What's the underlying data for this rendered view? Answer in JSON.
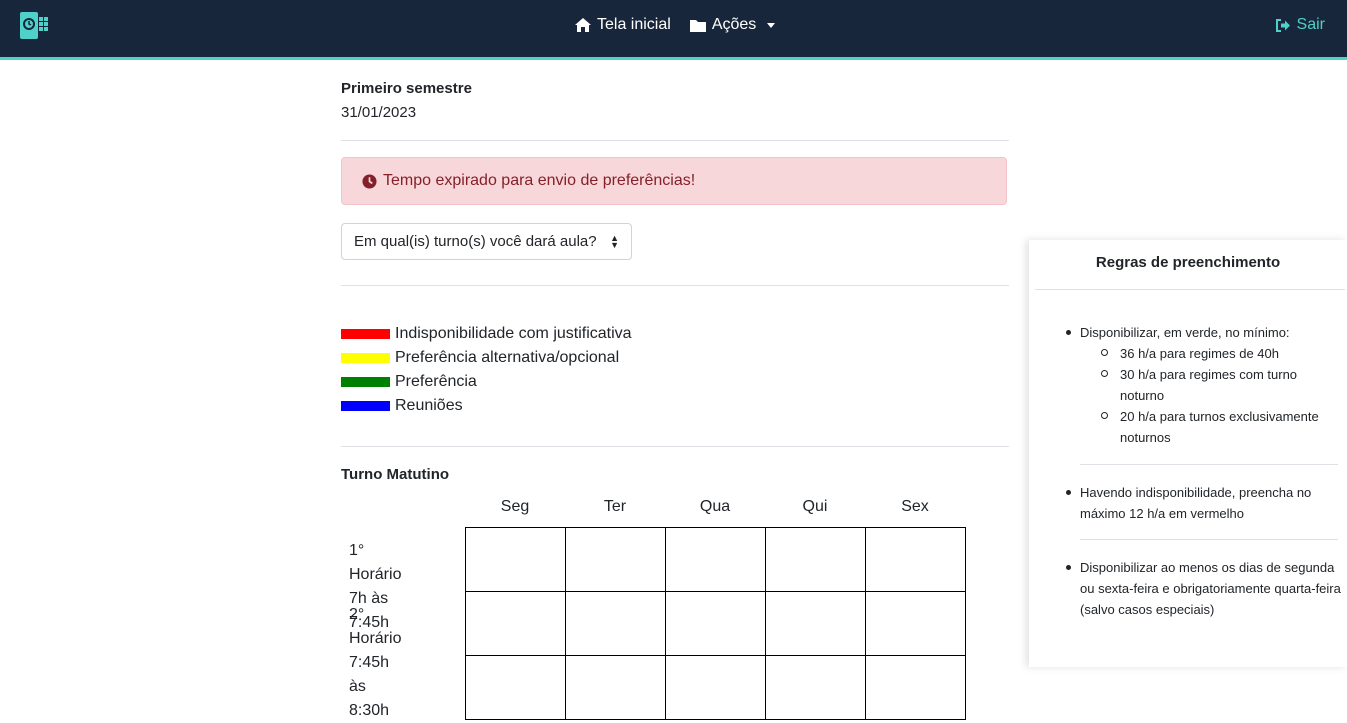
{
  "nav": {
    "home_label": "Tela inicial",
    "actions_label": "Ações",
    "logout_label": "Sair"
  },
  "semester": {
    "title": "Primeiro semestre",
    "date": "31/01/2023"
  },
  "alert": {
    "text": "Tempo expirado para envio de preferências!"
  },
  "shift_select": {
    "value": "Em qual(is) turno(s) você dará aula?"
  },
  "legend": [
    {
      "label": "Indisponibilidade com justificativa",
      "color": "#ff0000"
    },
    {
      "label": "Preferência alternativa/opcional",
      "color": "#ffff00"
    },
    {
      "label": "Preferência",
      "color": "#008000"
    },
    {
      "label": "Reuniões",
      "color": "#0000ff"
    }
  ],
  "schedule": {
    "shift_title": "Turno Matutino",
    "days": [
      "Seg",
      "Ter",
      "Qua",
      "Qui",
      "Sex"
    ],
    "slots": [
      {
        "name": "1° Horário",
        "time": "7h às 7:45h"
      },
      {
        "name": "2° Horário",
        "time": "7:45h às 8:30h"
      }
    ]
  },
  "rules": {
    "title": "Regras de preenchimento",
    "r1_intro": "Disponibilizar, em verde, no mínimo:",
    "r1_sub": [
      "36 h/a para regimes de 40h",
      "30 h/a para regimes com turno noturno",
      "20 h/a para turnos exclusivamente noturnos"
    ],
    "r2": "Havendo indisponibilidade, preencha no máximo 12 h/a em vermelho",
    "r3": "Disponibilizar ao menos os dias de segunda ou sexta-feira e obrigatoriamente quarta-feira (salvo casos especiais)"
  },
  "colors": {
    "navbar": "#17263a",
    "accent": "#4fd0c8",
    "alert_bg": "#f8d7da",
    "alert_text": "#842029"
  }
}
